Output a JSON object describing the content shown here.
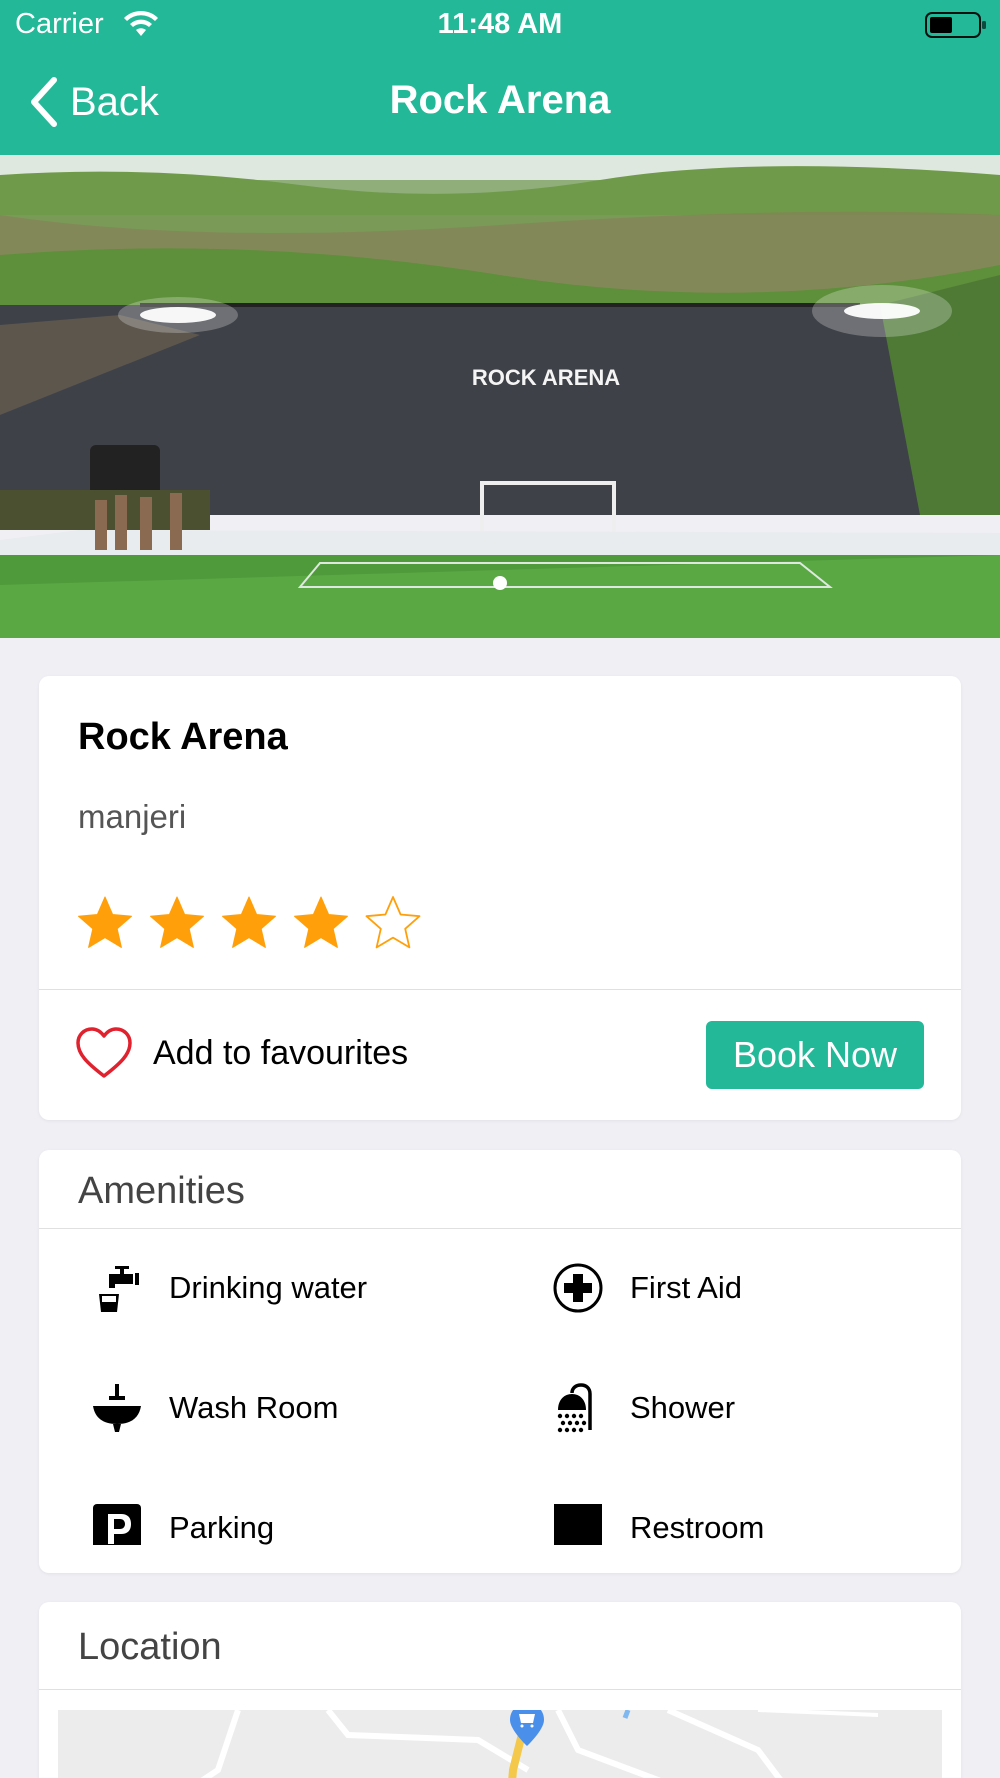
{
  "status_bar": {
    "carrier": "Carrier",
    "time": "11:48 AM"
  },
  "nav": {
    "back_label": "Back",
    "title": "Rock Arena"
  },
  "hero": {
    "sign_text": "ROCK ARENA",
    "page_count": 1,
    "current_page": 1
  },
  "venue": {
    "name": "Rock Arena",
    "location": "manjeri",
    "rating": 4,
    "rating_max": 5
  },
  "actions": {
    "favourite_label": "Add to favourites",
    "book_label": "Book Now"
  },
  "amenities": {
    "title": "Amenities",
    "items": [
      {
        "label": "Drinking water",
        "icon": "tap-icon"
      },
      {
        "label": "First Aid",
        "icon": "first-aid-icon"
      },
      {
        "label": "Wash Room",
        "icon": "washbasin-icon"
      },
      {
        "label": "Shower",
        "icon": "shower-icon"
      },
      {
        "label": "Parking",
        "icon": "parking-icon"
      },
      {
        "label": "Restroom",
        "icon": "restroom-icon"
      }
    ]
  },
  "location": {
    "title": "Location"
  },
  "colors": {
    "brand": "#22b898",
    "star": "#ff9f0a",
    "heart": "#e0212e"
  }
}
